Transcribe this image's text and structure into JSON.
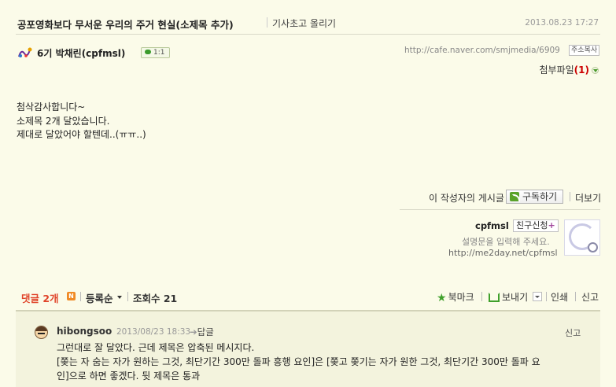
{
  "header": {
    "title": "공포영화보다 무서운 우리의 주거 현실(소제목 추가)",
    "report_link": "기사초고 올리기",
    "date": "2013.08.23 17:27"
  },
  "author": {
    "icon": "member-level-icon",
    "name": "6기 박채린(cpfmsl)",
    "chat_badge": "1:1",
    "post_url": "http://cafe.naver.com/smjmedia/6909",
    "copy_button": "주소복사"
  },
  "attachments": {
    "label": "첨부파일",
    "count_text": "(1)"
  },
  "body": {
    "lines": [
      "첨삭감사합니다~",
      "소제목 2개 달았습니다.",
      "제대로 달았어야 할텐데..(ㅠㅠ..)"
    ]
  },
  "writer": {
    "posts_label": "이 작성자의 게시글",
    "subscribe_button": "구독하기",
    "more_link": "더보기"
  },
  "profile": {
    "id": "cpfmsl",
    "friend_button": "친구신청",
    "friend_plus": "+",
    "description": "설명문을 입력해 주세요.",
    "url": "http://me2day.net/cpfmsl"
  },
  "comments_bar": {
    "comments_label": "댓글 2개",
    "new_badge": "N",
    "sort_label": "등록순",
    "views_label": "조회수 21",
    "bookmark": "북마크",
    "send": "보내기",
    "print": "인쇄",
    "report": "신고"
  },
  "comment": {
    "author": "hibongsoo",
    "date": "2013/08/23 18:33",
    "reply_arrow": "➔",
    "reply_label": "답글",
    "report": "신고",
    "lines": [
      "그런대로 잘 달았다. 근데 제목은 압축된 메시지다.",
      "[쫒는 자 숨는 자가 원하는 그것, 최단기간 300만 돌파 흥행 요인]은 [쫒고 쫒기는 자가 원한 그것, 최단기간 300만 돌파 요",
      "인]으로 하면 좋겠다. 뒷 제목은 통과"
    ]
  },
  "colors": {
    "background": "#fbfbe9",
    "comment_accent": "#e0442a",
    "green_accent": "#3fa02b",
    "comment_box": "#f3f3dd"
  }
}
